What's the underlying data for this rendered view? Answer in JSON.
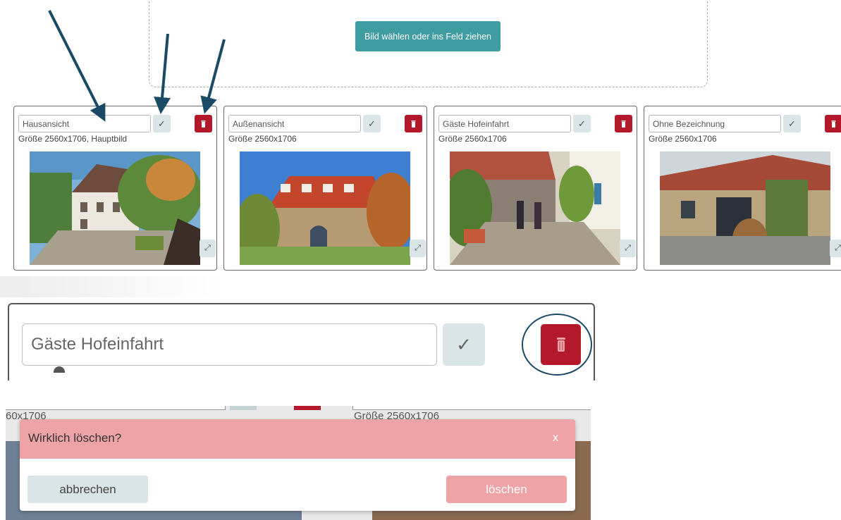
{
  "upload": {
    "button_label": "Bild wählen oder ins Feld ziehen"
  },
  "cards": [
    {
      "name": "Hausansicht",
      "size": "Größe 2560x1706, Hauptbild",
      "confirm": "✓",
      "expand": "⤢"
    },
    {
      "name": "Außenansicht",
      "size": "Größe 2560x1706",
      "confirm": "✓",
      "expand": "⤢"
    },
    {
      "name": "Gäste Hofeinfahrt",
      "size": "Größe 2560x1706",
      "confirm": "✓",
      "expand": "⤢"
    },
    {
      "name": "Ohne Bezeichnung",
      "size": "Größe 2560x1706",
      "confirm": "✓",
      "expand": "⤢"
    }
  ],
  "zoom": {
    "name": "Gäste Hofeinfahrt",
    "confirm": "✓"
  },
  "dialog_background": {
    "left_size": "60x1706",
    "right_size": "Größe 2560x1706"
  },
  "dialog": {
    "title": "Wirklich löschen?",
    "close": "x",
    "cancel": "abbrechen",
    "delete": "löschen"
  },
  "colors": {
    "teal": "#3f9da2",
    "delete_red": "#b3192b",
    "confirm_grey": "#d9e5e6",
    "dialog_pink": "#eea3a6",
    "arrow_blue": "#1a4a66"
  }
}
